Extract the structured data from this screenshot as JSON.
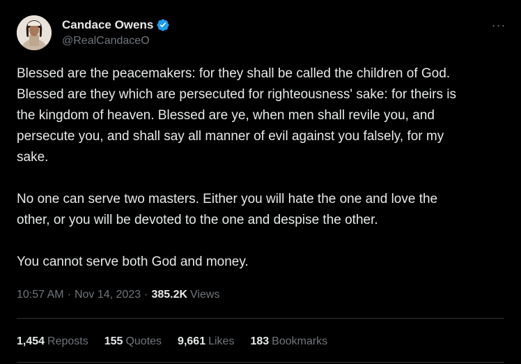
{
  "author": {
    "display_name": "Candace Owens",
    "handle": "@RealCandaceO",
    "verified_icon": "verified-badge-icon",
    "verified_color": "#1d9bf0"
  },
  "more_icon": "ellipsis-icon",
  "more_label": "···",
  "tweet": {
    "paragraphs": [
      {
        "lines": [
          "Blessed are the peacemakers: for they shall be called the children of God.",
          "Blessed are they which are persecuted for righteousness' sake: for theirs is",
          "the kingdom of heaven. Blessed are ye, when men shall revile you, and",
          "persecute you, and shall say all manner of evil against you falsely, for my",
          "sake."
        ]
      },
      {
        "lines": [
          "No one can serve two masters. Either you will hate the one and love the",
          "other, or you will be devoted to the one and despise the other."
        ]
      },
      {
        "lines": [
          "You cannot serve both God and money."
        ]
      }
    ]
  },
  "meta": {
    "time": "10:57 AM",
    "separator": "·",
    "date": "Nov 14, 2023",
    "views_count": "385.2K",
    "views_label": "Views"
  },
  "stats": {
    "reposts": {
      "count": "1,454",
      "label": "Reposts"
    },
    "quotes": {
      "count": "155",
      "label": "Quotes"
    },
    "likes": {
      "count": "9,661",
      "label": "Likes"
    },
    "bookmarks": {
      "count": "183",
      "label": "Bookmarks"
    }
  }
}
